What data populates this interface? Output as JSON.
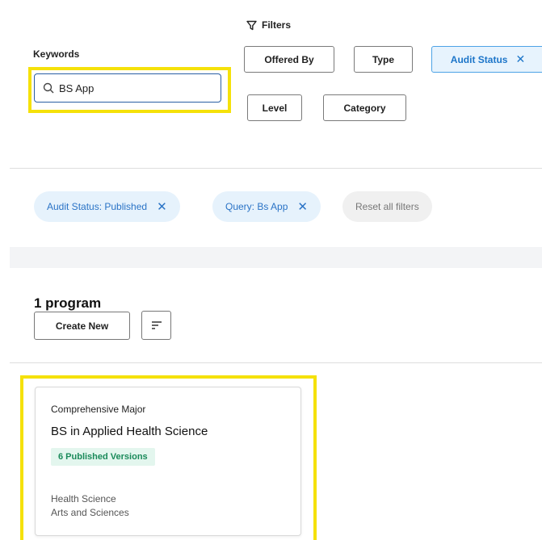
{
  "search": {
    "label": "Keywords",
    "value": "BS App",
    "placeholder": ""
  },
  "filters": {
    "title": "Filters",
    "buttons": [
      {
        "label": "Offered By"
      },
      {
        "label": "Type"
      },
      {
        "label": "Audit Status",
        "active": true
      },
      {
        "label": "Level"
      },
      {
        "label": "Category"
      }
    ]
  },
  "applied_filters": {
    "chips": [
      {
        "label": "Audit Status: Published"
      },
      {
        "label": "Query: Bs App"
      }
    ],
    "reset_label": "Reset all filters"
  },
  "results": {
    "count_label": "1 program",
    "create_label": "Create New",
    "sort_icon": "sort-icon"
  },
  "card": {
    "type": "Comprehensive Major",
    "title": "BS in Applied Health Science",
    "badge": "6 Published Versions",
    "department": "Health Science",
    "college": "Arts and Sciences"
  },
  "colors": {
    "highlight": "#f5e10a",
    "accent": "#1c75c9",
    "chip_bg": "#e6f2fc",
    "badge_bg": "#e3f6ee",
    "badge_text": "#1a8a5a"
  }
}
